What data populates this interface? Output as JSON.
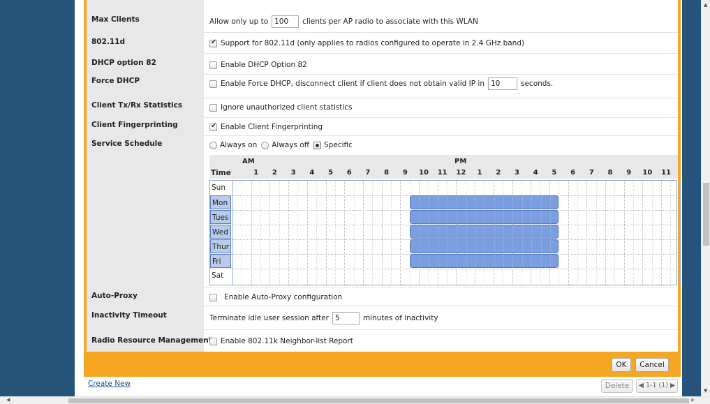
{
  "form": {
    "max_clients": {
      "label": "Max Clients",
      "prefix": "Allow only up to",
      "value": "100",
      "suffix": "clients per AP radio to associate with this WLAN"
    },
    "dot11d": {
      "label": "802.11d",
      "checked": true,
      "text": "Support for 802.11d (only applies to radios configured to operate in 2.4 GHz band)"
    },
    "dhcp_option82": {
      "label": "DHCP option 82",
      "checked": false,
      "text": "Enable DHCP Option 82"
    },
    "force_dhcp": {
      "label": "Force DHCP",
      "checked": false,
      "text": "Enable Force DHCP, disconnect client if client does not obtain valid IP in",
      "value": "10",
      "suffix": "seconds."
    },
    "client_stats": {
      "label": "Client Tx/Rx Statistics",
      "checked": false,
      "text": "Ignore unauthorized client statistics"
    },
    "fingerprinting": {
      "label": "Client Fingerprinting",
      "checked": true,
      "text": "Enable Client Fingerprinting"
    },
    "service_schedule": {
      "label": "Service Schedule",
      "options": [
        "Always on",
        "Always off",
        "Specific"
      ],
      "selected": "Specific"
    },
    "auto_proxy": {
      "label": "Auto-Proxy",
      "checked": false,
      "text": "Enable Auto-Proxy configuration"
    },
    "inactivity": {
      "label": "Inactivity Timeout",
      "prefix": "Terminate idle user session after",
      "value": "5",
      "suffix": "minutes of inactivity"
    },
    "rrm": {
      "label": "Radio Resource Management",
      "checked": false,
      "text": "Enable 802.11k Neighbor-list Report"
    }
  },
  "schedule": {
    "am_label": "AM",
    "pm_label": "PM",
    "time_label": "Time",
    "hours": [
      "1",
      "2",
      "3",
      "4",
      "5",
      "6",
      "7",
      "8",
      "9",
      "10",
      "11",
      "12",
      "1",
      "2",
      "3",
      "4",
      "5",
      "6",
      "7",
      "8",
      "9",
      "10",
      "11"
    ],
    "days": [
      "Sun",
      "Mon",
      "Tues",
      "Wed",
      "Thur",
      "Fri",
      "Sat"
    ],
    "selected_days": [
      "Mon",
      "Tues",
      "Wed",
      "Thur",
      "Fri"
    ],
    "selected_range": {
      "start": "9 AM",
      "end": "5 PM"
    }
  },
  "footer": {
    "ok_label": "OK",
    "cancel_label": "Cancel"
  },
  "list_footer": {
    "create_new": "Create New",
    "delete_label": "Delete",
    "pager": "1-1 (1)"
  }
}
